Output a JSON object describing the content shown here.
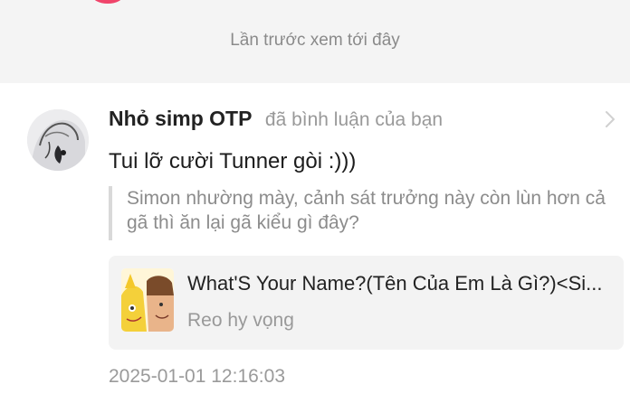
{
  "divider": {
    "label": "Lần trước xem tới đây"
  },
  "notification": {
    "username": "Nhỏ simp OTP",
    "action": "đã bình luận của bạn",
    "comment": "Tui lỡ cười Tunner gòi :)))",
    "quoted": "Simon nhường mày, cảnh sát trưởng này còn lùn hơn cả gã thì ăn lại gã kiểu gì đây?",
    "story": {
      "title": "What'S Your Name?(Tên Của Em Là Gì?)<Si...",
      "author": "Reo hy vọng"
    },
    "timestamp": "2025-01-01 12:16:03"
  },
  "colors": {
    "accent_badge": "#f0446a",
    "divider_bg": "#f4f4f4",
    "card_bg": "#f3f3f3"
  },
  "icons": {
    "chevron": "chevron-right-icon"
  }
}
